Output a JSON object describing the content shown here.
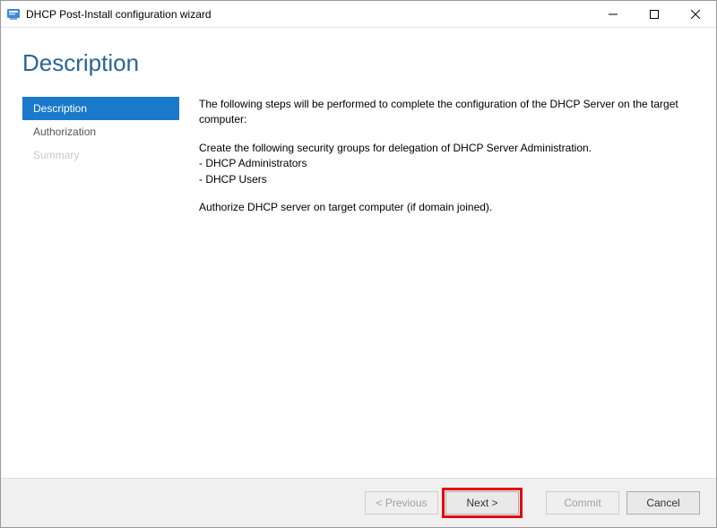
{
  "titlebar": {
    "title": "DHCP Post-Install configuration wizard"
  },
  "heading": "Description",
  "sidebar": {
    "items": [
      {
        "label": "Description",
        "state": "active"
      },
      {
        "label": "Authorization",
        "state": "normal"
      },
      {
        "label": "Summary",
        "state": "disabled"
      }
    ]
  },
  "content": {
    "intro": "The following steps will be performed to complete the configuration of the DHCP Server on the target computer:",
    "groups_intro": "Create the following security groups for delegation of DHCP Server Administration.",
    "groups": [
      "- DHCP Administrators",
      "- DHCP Users"
    ],
    "authorize": "Authorize DHCP server on target computer (if domain joined)."
  },
  "footer": {
    "previous": "< Previous",
    "next": "Next >",
    "commit": "Commit",
    "cancel": "Cancel"
  }
}
